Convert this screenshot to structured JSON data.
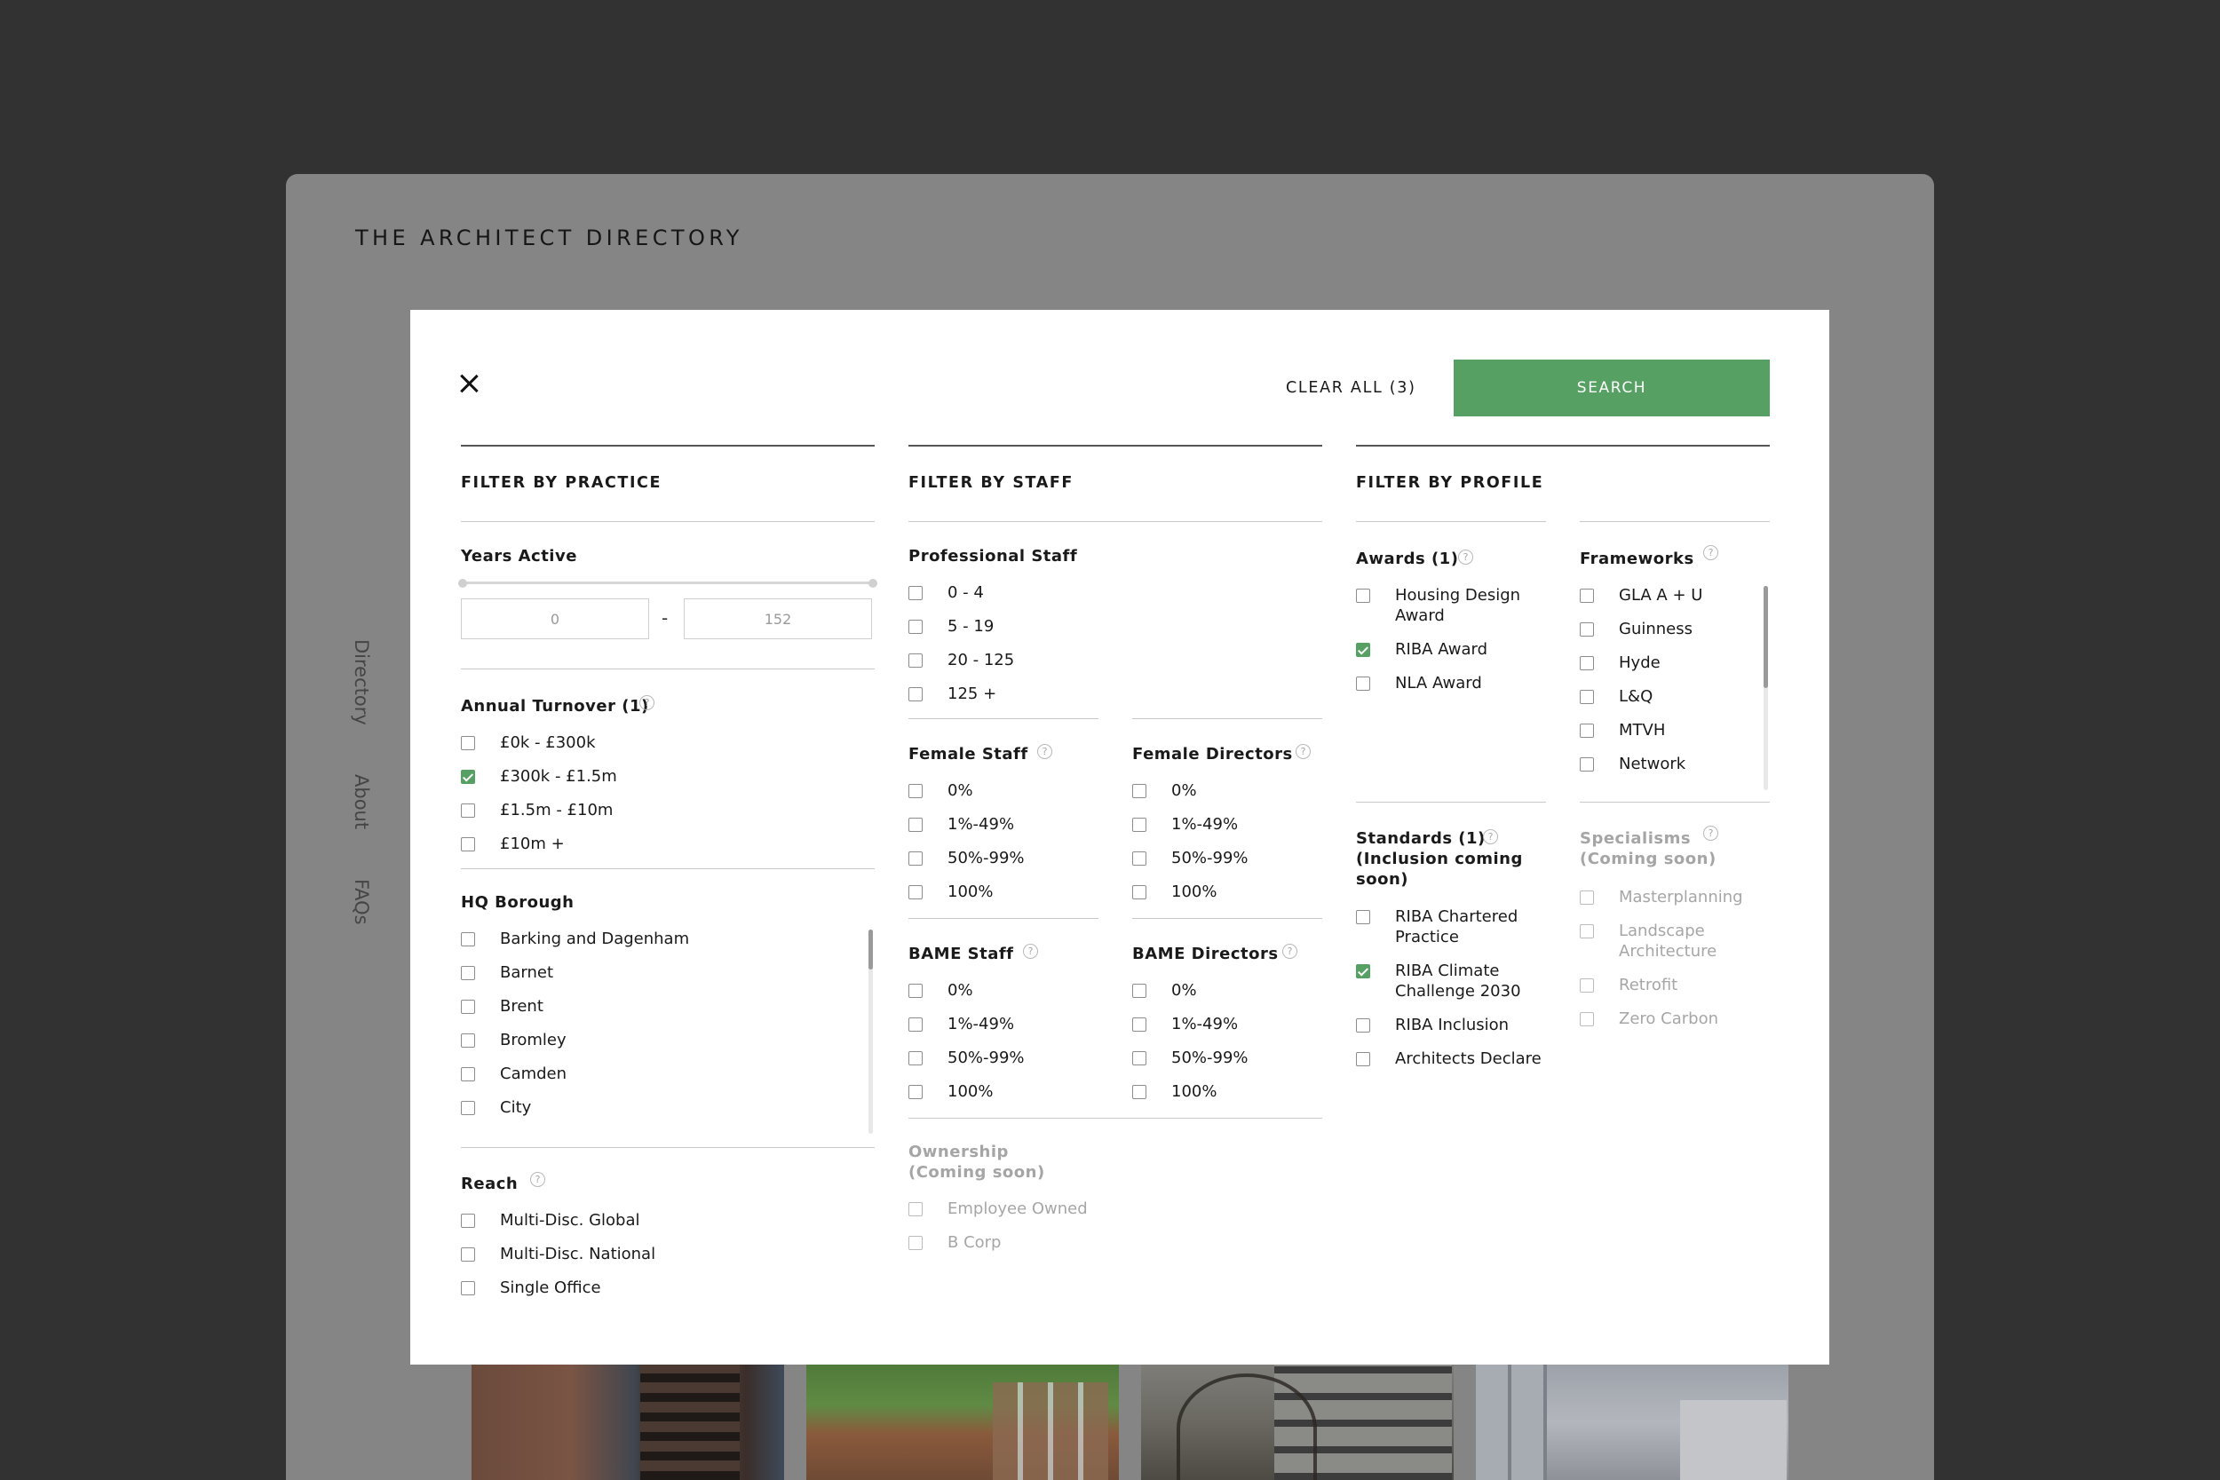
{
  "site": {
    "title": "THE ARCHITECT DIRECTORY",
    "nav": [
      "Directory",
      "About",
      "FAQs"
    ]
  },
  "colors": {
    "accent": "#55a062",
    "background": "#323232",
    "overlay": "#858585"
  },
  "modal": {
    "clear_all_label": "CLEAR ALL (3)",
    "search_label": "SEARCH",
    "practice": {
      "title": "FILTER BY PRACTICE",
      "years_active": {
        "label": "Years Active",
        "min": "0",
        "max": "152"
      },
      "turnover": {
        "label": "Annual Turnover (1)",
        "options": [
          {
            "label": "£0k - £300k",
            "checked": false
          },
          {
            "label": "£300k - £1.5m",
            "checked": true
          },
          {
            "label": "£1.5m - £10m",
            "checked": false
          },
          {
            "label": "£10m +",
            "checked": false
          }
        ]
      },
      "borough": {
        "label": "HQ Borough",
        "options": [
          "Barking and Dagenham",
          "Barnet",
          "Brent",
          "Bromley",
          "Camden",
          "City"
        ]
      },
      "reach": {
        "label": "Reach",
        "options": [
          "Multi-Disc. Global",
          "Multi-Disc. National",
          "Single Office"
        ]
      }
    },
    "staff": {
      "title": "FILTER BY STAFF",
      "professional": {
        "label": "Professional Staff",
        "options": [
          "0 - 4",
          "5 - 19",
          "20 - 125",
          "125 +"
        ]
      },
      "female_staff": {
        "label": "Female Staff",
        "options": [
          "0%",
          "1%-49%",
          "50%-99%",
          "100%"
        ]
      },
      "female_directors": {
        "label": "Female Directors",
        "options": [
          "0%",
          "1%-49%",
          "50%-99%",
          "100%"
        ]
      },
      "bame_staff": {
        "label": "BAME Staff",
        "options": [
          "0%",
          "1%-49%",
          "50%-99%",
          "100%"
        ]
      },
      "bame_directors": {
        "label": "BAME Directors",
        "options": [
          "0%",
          "1%-49%",
          "50%-99%",
          "100%"
        ]
      },
      "ownership": {
        "label": "Ownership",
        "sub": "(Coming soon)",
        "options": [
          "Employee Owned",
          "B Corp"
        ]
      }
    },
    "profile": {
      "title": "FILTER BY PROFILE",
      "awards": {
        "label": "Awards (1)",
        "options": [
          {
            "label": "Housing Design Award",
            "checked": false
          },
          {
            "label": "RIBA Award",
            "checked": true
          },
          {
            "label": "NLA Award",
            "checked": false
          }
        ]
      },
      "frameworks": {
        "label": "Frameworks",
        "options": [
          "GLA A + U",
          "Guinness",
          "Hyde",
          "L&Q",
          "MTVH",
          "Network"
        ]
      },
      "standards": {
        "label": "Standards (1)",
        "sub": "(Inclusion coming soon)",
        "options": [
          {
            "label": "RIBA Chartered Practice",
            "checked": false
          },
          {
            "label": "RIBA Climate Challenge 2030",
            "checked": true
          },
          {
            "label": "RIBA Inclusion",
            "checked": false
          },
          {
            "label": "Architects Declare",
            "checked": false
          }
        ]
      },
      "specialisms": {
        "label": "Specialisms",
        "sub": "(Coming soon)",
        "options": [
          "Masterplanning",
          "Landscape Architecture",
          "Retrofit",
          "Zero Carbon"
        ]
      }
    }
  }
}
